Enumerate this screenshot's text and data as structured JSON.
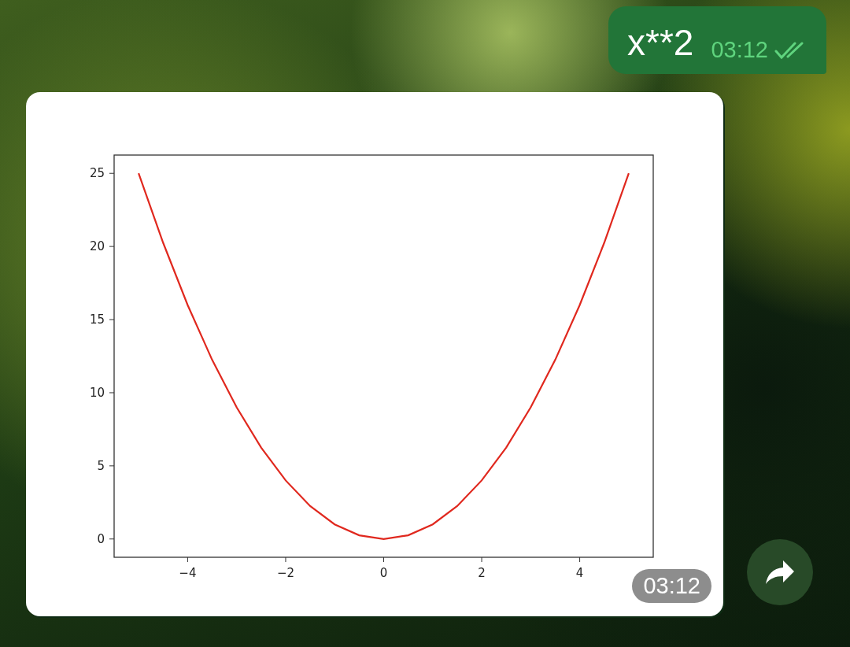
{
  "outgoing_message": {
    "text": "x**2",
    "time": "03:12",
    "read": true
  },
  "image_message": {
    "time": "03:12",
    "chart_data": {
      "type": "line",
      "x": [
        -5,
        -4.5,
        -4,
        -3.5,
        -3,
        -2.5,
        -2,
        -1.5,
        -1,
        -0.5,
        0,
        0.5,
        1,
        1.5,
        2,
        2.5,
        3,
        3.5,
        4,
        4.5,
        5
      ],
      "series": [
        {
          "color": "#e0281e",
          "values": [
            25,
            20.25,
            16,
            12.25,
            9,
            6.25,
            4,
            2.25,
            1,
            0.25,
            0,
            0.25,
            1,
            2.25,
            4,
            6.25,
            9,
            12.25,
            16,
            20.25,
            25
          ]
        }
      ],
      "xlim": [
        -5.5,
        5.5
      ],
      "ylim": [
        -1.25,
        26.25
      ],
      "xticks": [
        {
          "value": -4,
          "label": "−4"
        },
        {
          "value": -2,
          "label": "−2"
        },
        {
          "value": 0,
          "label": "0"
        },
        {
          "value": 2,
          "label": "2"
        },
        {
          "value": 4,
          "label": "4"
        }
      ],
      "yticks": [
        0,
        5,
        10,
        15,
        20,
        25
      ]
    }
  }
}
